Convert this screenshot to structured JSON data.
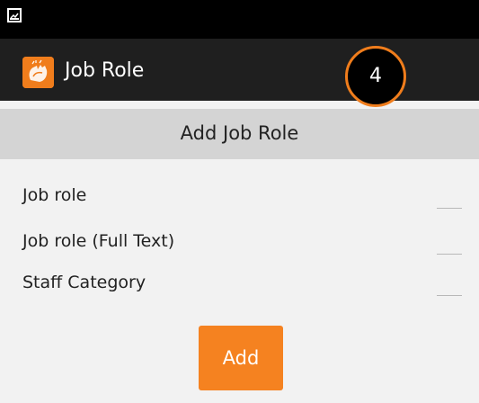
{
  "app": {
    "title": "Job Role",
    "step_badge": "4",
    "accent_color": "#f07d1c",
    "app_icon": "hands-icon",
    "status_icon": "image-notification-icon"
  },
  "form": {
    "header": "Add Job Role",
    "fields": [
      {
        "label": "Job role",
        "value": ""
      },
      {
        "label": "Job role (Full Text)",
        "value": ""
      },
      {
        "label": "Staff Category",
        "value": ""
      }
    ],
    "submit_label": "Add"
  }
}
